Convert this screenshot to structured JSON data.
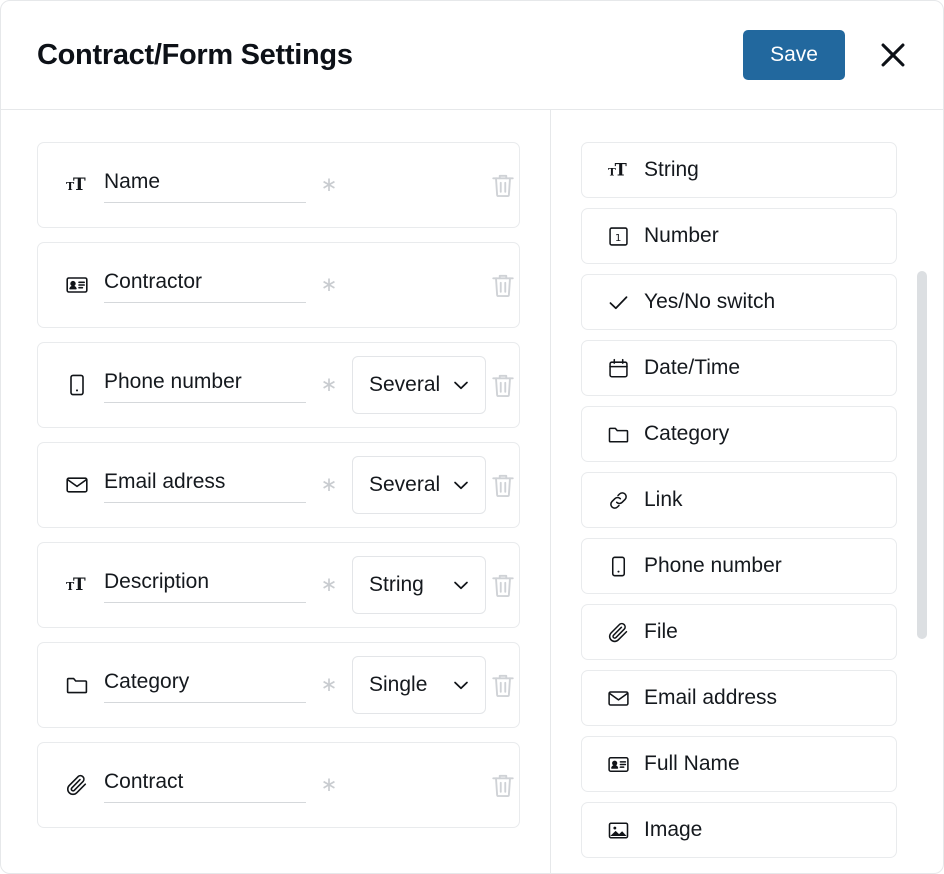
{
  "header": {
    "title": "Contract/Form Settings",
    "save_label": "Save",
    "close_icon": "close-icon",
    "accent_color": "#22689e"
  },
  "form_fields": {
    "required_mark": "∗",
    "rows": [
      {
        "icon": "string-icon",
        "name": "Name",
        "required": "∗",
        "type": null,
        "delete_icon": "trash-icon"
      },
      {
        "icon": "id-card-icon",
        "name": "Contractor",
        "required": "∗",
        "type": null,
        "delete_icon": "trash-icon"
      },
      {
        "icon": "phone-icon",
        "name": "Phone number",
        "required": "∗",
        "type": "Several",
        "delete_icon": "trash-icon"
      },
      {
        "icon": "envelope-icon",
        "name": "Email adress",
        "required": "∗",
        "type": "Several",
        "delete_icon": "trash-icon"
      },
      {
        "icon": "string-icon",
        "name": "Description",
        "required": "∗",
        "type": "String",
        "delete_icon": "trash-icon"
      },
      {
        "icon": "folder-icon",
        "name": "Category",
        "required": "∗",
        "type": "Single",
        "delete_icon": "trash-icon"
      },
      {
        "icon": "paperclip-icon",
        "name": "Contract",
        "required": "∗",
        "type": null,
        "delete_icon": "trash-icon"
      }
    ]
  },
  "type_palette": {
    "items": [
      {
        "icon": "string-icon",
        "label": "String"
      },
      {
        "icon": "number-icon",
        "label": "Number"
      },
      {
        "icon": "check-icon",
        "label": "Yes/No switch"
      },
      {
        "icon": "calendar-icon",
        "label": "Date/Time"
      },
      {
        "icon": "folder-icon",
        "label": "Category"
      },
      {
        "icon": "link-icon",
        "label": "Link"
      },
      {
        "icon": "phone-icon",
        "label": "Phone number"
      },
      {
        "icon": "paperclip-icon",
        "label": "File"
      },
      {
        "icon": "envelope-icon",
        "label": "Email address"
      },
      {
        "icon": "id-card-icon",
        "label": "Full Name"
      },
      {
        "icon": "image-icon",
        "label": "Image"
      }
    ]
  },
  "scrollbar": {
    "name": "palette-scrollbar",
    "thumb_color": "#dcdfe2"
  }
}
